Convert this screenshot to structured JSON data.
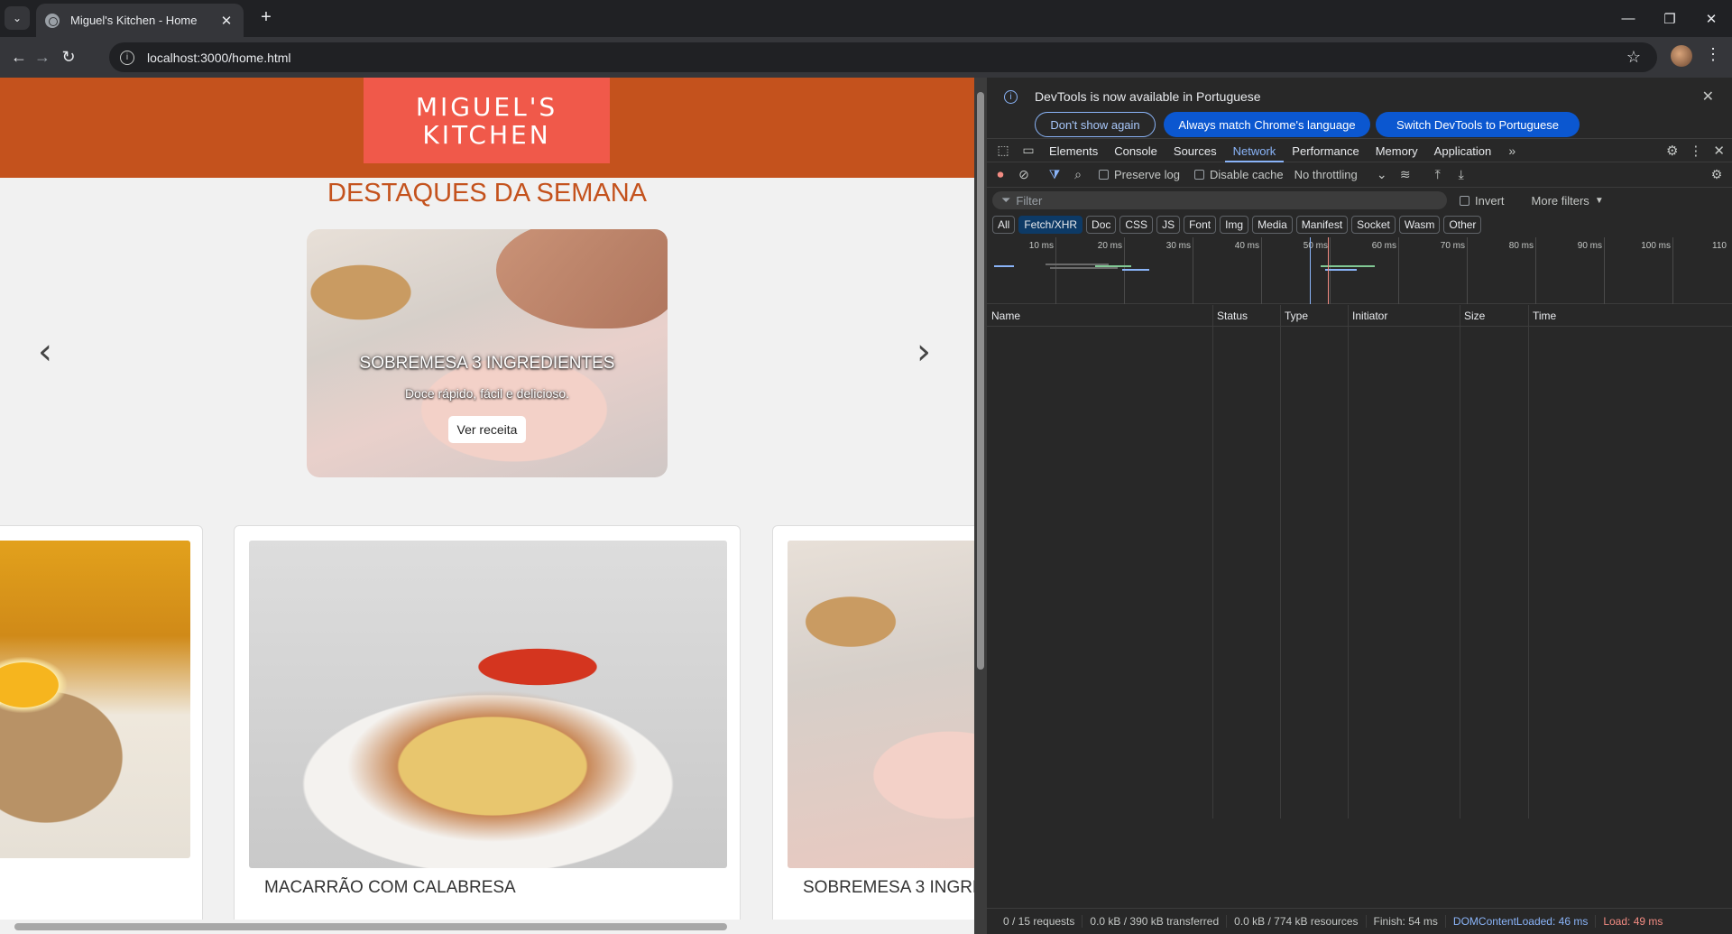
{
  "browser": {
    "tab_title": "Miguel's Kitchen - Home",
    "url": "localhost:3000/home.html"
  },
  "site": {
    "logo_line1": "MIGUEL'S",
    "logo_line2": "KITCHEN",
    "section_title": "DESTAQUES DA SEMANA",
    "carousel": {
      "title": "SOBREMESA 3 INGREDIENTES",
      "subtitle": "Doce rápido, fácil e delicioso.",
      "button": "Ver receita",
      "prev_arrow": "‹",
      "next_arrow": "›"
    },
    "recipe_cards": [
      {
        "title": ""
      },
      {
        "title": "MACARRÃO COM CALABRESA"
      },
      {
        "title": "SOBREMESA 3 INGRE"
      }
    ]
  },
  "devtools": {
    "language_bar": {
      "message": "DevTools is now available in Portuguese",
      "dont_show": "Don't show again",
      "always_match": "Always match Chrome's language",
      "switch": "Switch DevTools to Portuguese"
    },
    "tabs": [
      "Elements",
      "Console",
      "Sources",
      "Network",
      "Performance",
      "Memory",
      "Application"
    ],
    "active_tab": "Network",
    "toolbar": {
      "preserve_log": "Preserve log",
      "disable_cache": "Disable cache",
      "throttling": "No throttling"
    },
    "filter": {
      "placeholder": "Filter",
      "invert": "Invert",
      "more_filters": "More filters"
    },
    "type_filters": [
      "All",
      "Fetch/XHR",
      "Doc",
      "CSS",
      "JS",
      "Font",
      "Img",
      "Media",
      "Manifest",
      "Socket",
      "Wasm",
      "Other"
    ],
    "active_type": "Fetch/XHR",
    "timeline_ticks": [
      "10 ms",
      "20 ms",
      "30 ms",
      "40 ms",
      "50 ms",
      "60 ms",
      "70 ms",
      "80 ms",
      "90 ms",
      "100 ms",
      "110"
    ],
    "columns": [
      "Name",
      "Status",
      "Type",
      "Initiator",
      "Size",
      "Time"
    ],
    "status_bar": {
      "requests": "0 / 15 requests",
      "transferred": "0.0 kB / 390 kB transferred",
      "resources": "0.0 kB / 774 kB resources",
      "finish": "Finish: 54 ms",
      "dom_content_loaded": "DOMContentLoaded: 46 ms",
      "load": "Load: 49 ms"
    }
  },
  "colors": {
    "header_orange": "#c4521d",
    "logo_red": "#f0594a",
    "devtools_accent": "#8ab4f8"
  }
}
